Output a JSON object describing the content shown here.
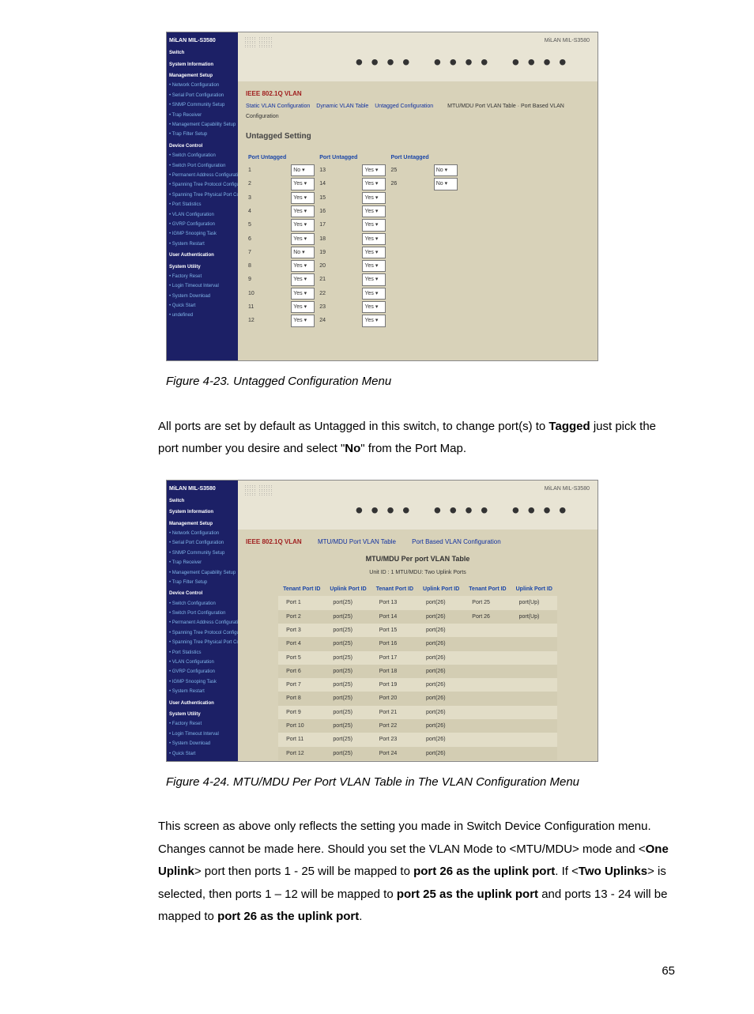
{
  "page_number": "65",
  "fig1": {
    "caption": "Figure 4-23. Untagged Configuration Menu",
    "brand": "MiLAN MIL-S3580",
    "banner_label": "MiLAN MIL-S3580",
    "nav_sections": {
      "switch": "Switch",
      "system_info": "System Information",
      "mgmt_setup": "Management Setup",
      "dev_ctrl": "Device Control",
      "user_auth": "User Authentication",
      "sys_util": "System Utility"
    },
    "nav_items": [
      "Network Configuration",
      "Serial Port Configuration",
      "SNMP Community Setup",
      "Trap Receiver",
      "Management Capability Setup",
      "Trap Filter Setup",
      "Switch Configuration",
      "Switch Port Configuration",
      "Permanent Address Configuration",
      "Spanning Tree Protocol Configuration",
      "Spanning Tree Physical Port Configuration",
      "Port Statistics",
      "VLAN Configuration",
      "GVRP Configuration",
      "IGMP Snooping Task",
      "System Restart",
      "Factory Reset",
      "Login Timeout Interval",
      "System Download",
      "Quick Start"
    ],
    "crumbs": "IEEE 802.1Q VLAN",
    "sublinks": [
      "Static VLAN Configuration",
      "Dynamic VLAN Table",
      "Untagged Configuration"
    ],
    "right_note": "MTU/MDU Port VLAN Table · Port Based VLAN Configuration",
    "section_title": "Untagged Setting",
    "col_label": "Port Untagged",
    "rows": [
      {
        "p": "1",
        "v": "No"
      },
      {
        "p": "13",
        "v": "Yes"
      },
      {
        "p": "25",
        "v": "No"
      },
      {
        "p": "2",
        "v": "Yes"
      },
      {
        "p": "14",
        "v": "Yes"
      },
      {
        "p": "26",
        "v": "No"
      },
      {
        "p": "3",
        "v": "Yes"
      },
      {
        "p": "15",
        "v": "Yes"
      },
      {
        "p": "4",
        "v": "Yes"
      },
      {
        "p": "16",
        "v": "Yes"
      },
      {
        "p": "5",
        "v": "Yes"
      },
      {
        "p": "17",
        "v": "Yes"
      },
      {
        "p": "6",
        "v": "Yes"
      },
      {
        "p": "18",
        "v": "Yes"
      },
      {
        "p": "7",
        "v": "No"
      },
      {
        "p": "19",
        "v": "Yes"
      },
      {
        "p": "8",
        "v": "Yes"
      },
      {
        "p": "20",
        "v": "Yes"
      },
      {
        "p": "9",
        "v": "Yes"
      },
      {
        "p": "21",
        "v": "Yes"
      },
      {
        "p": "10",
        "v": "Yes"
      },
      {
        "p": "22",
        "v": "Yes"
      },
      {
        "p": "11",
        "v": "Yes"
      },
      {
        "p": "23",
        "v": "Yes"
      },
      {
        "p": "12",
        "v": "Yes"
      },
      {
        "p": "24",
        "v": "Yes"
      }
    ]
  },
  "para1": {
    "t1": "All ports are set by default as Untagged in this switch, to change port(s) to ",
    "b1": "Tagged",
    "t2": " just pick the port number you desire and select \"",
    "b2": "No",
    "t3": "\" from the Port Map."
  },
  "fig2": {
    "caption": "Figure 4-24. MTU/MDU Per Port VLAN Table in The VLAN Configuration Menu",
    "brand": "MiLAN MIL-S3580",
    "banner_label": "MiLAN MIL-S3580",
    "tabs": {
      "t1": "IEEE 802.1Q VLAN",
      "t2": "MTU/MDU Port VLAN Table",
      "t3": "Port Based VLAN Configuration"
    },
    "title": "MTU/MDU Per port VLAN Table",
    "subtitle": "Unit ID : 1 MTU/MDU: Two Uplink Ports",
    "head": {
      "h1": "Tenant Port ID",
      "h2": "Uplink Port ID"
    },
    "rows": [
      {
        "a": "Port 1",
        "b": "port(25)",
        "c": "Port 13",
        "d": "port(26)",
        "e": "Port 25",
        "f": "port(Up)"
      },
      {
        "a": "Port 2",
        "b": "port(25)",
        "c": "Port 14",
        "d": "port(26)",
        "e": "Port 26",
        "f": "port(Up)"
      },
      {
        "a": "Port 3",
        "b": "port(25)",
        "c": "Port 15",
        "d": "port(26)"
      },
      {
        "a": "Port 4",
        "b": "port(25)",
        "c": "Port 16",
        "d": "port(26)"
      },
      {
        "a": "Port 5",
        "b": "port(25)",
        "c": "Port 17",
        "d": "port(26)"
      },
      {
        "a": "Port 6",
        "b": "port(25)",
        "c": "Port 18",
        "d": "port(26)"
      },
      {
        "a": "Port 7",
        "b": "port(25)",
        "c": "Port 19",
        "d": "port(26)"
      },
      {
        "a": "Port 8",
        "b": "port(25)",
        "c": "Port 20",
        "d": "port(26)"
      },
      {
        "a": "Port 9",
        "b": "port(25)",
        "c": "Port 21",
        "d": "port(26)"
      },
      {
        "a": "Port 10",
        "b": "port(25)",
        "c": "Port 22",
        "d": "port(26)"
      },
      {
        "a": "Port 11",
        "b": "port(25)",
        "c": "Port 23",
        "d": "port(26)"
      },
      {
        "a": "Port 12",
        "b": "port(25)",
        "c": "Port 24",
        "d": "port(26)"
      }
    ]
  },
  "para2": {
    "t1": "This screen as above only reflects the setting you made in Switch Device Configuration menu.  Changes cannot be made here.  Should you set the VLAN Mode to <MTU/MDU> mode and <",
    "b1": "One Uplink",
    "t2": "> port then ports 1 - 25 will be mapped to ",
    "b2": "port 26 as the uplink port",
    "t3": ".  If <",
    "b3": "Two Uplinks",
    "t4": "> is selected, then ports 1 – 12 will be mapped to ",
    "b4": "port 25 as the uplink port",
    "t5": " and ports 13 - 24 will be mapped to ",
    "b5": "port 26 as the uplink port",
    "t6": "."
  }
}
